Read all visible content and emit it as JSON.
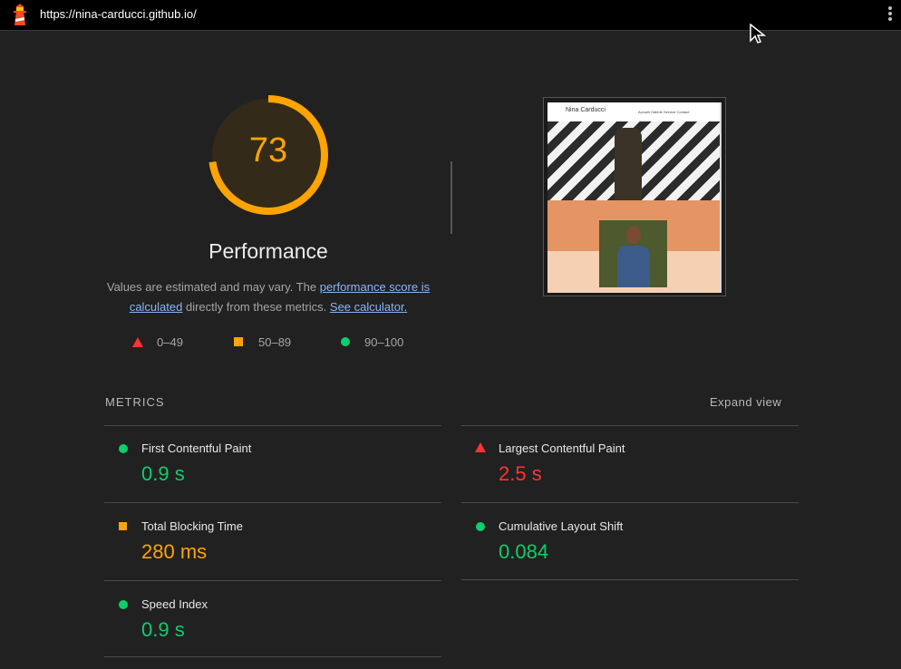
{
  "topbar": {
    "url": "https://nina-carducci.github.io/",
    "logo_icon": "lighthouse-icon",
    "menu_icon": "kebab-menu-icon"
  },
  "score": {
    "value": "73",
    "value_fraction": 0.73,
    "title": "Performance",
    "color": "#ffa400"
  },
  "description": {
    "text_before": "Values are estimated and may vary. The ",
    "link1": "performance score is calculated",
    "text_middle": " directly from these metrics. ",
    "link2": "See calculator."
  },
  "legend": [
    {
      "range": "0–49",
      "shape": "triangle",
      "color": "#ff3333"
    },
    {
      "range": "50–89",
      "shape": "square",
      "color": "#ffa400"
    },
    {
      "range": "90–100",
      "shape": "circle",
      "color": "#0cce6b"
    }
  ],
  "thumbnail": {
    "site_name": "Nina Carducci",
    "nav_links": "Accueil   Galerie   Service   Contact"
  },
  "metrics": {
    "heading": "METRICS",
    "expand_label": "Expand view",
    "items": [
      {
        "title": "First Contentful Paint",
        "value": "0.9 s",
        "rating": "pass"
      },
      {
        "title": "Largest Contentful Paint",
        "value": "2.5 s",
        "rating": "fail"
      },
      {
        "title": "Total Blocking Time",
        "value": "280 ms",
        "rating": "average"
      },
      {
        "title": "Cumulative Layout Shift",
        "value": "0.084",
        "rating": "pass"
      },
      {
        "title": "Speed Index",
        "value": "0.9 s",
        "rating": "pass"
      }
    ]
  }
}
